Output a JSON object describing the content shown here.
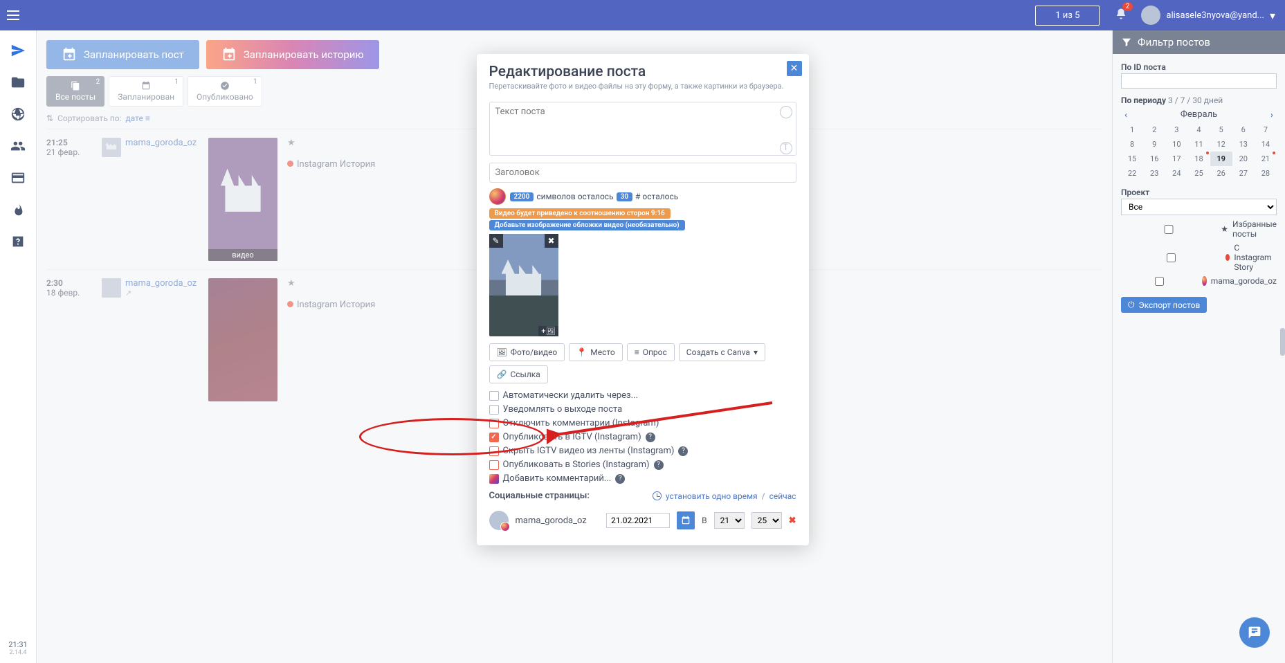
{
  "topbar": {
    "counter": "1 из 5",
    "notif_count": "2",
    "username": "alisasele3nyova@yand..."
  },
  "sidenav": {
    "time": "21:31",
    "version": "2.14.4"
  },
  "actions": {
    "plan_post": "Запланировать пост",
    "plan_story": "Запланировать историю"
  },
  "tabs": {
    "all": "Все посты",
    "all_cnt": "2",
    "planned": "Запланирован",
    "planned_cnt": "1",
    "published": "Опубликовано",
    "published_cnt": "1"
  },
  "sort": {
    "label": "Сортировать по:",
    "value": "дате"
  },
  "posts": [
    {
      "time": "21:25",
      "date": "21 февр.",
      "user": "mama_goroda_oz",
      "kind": "Instagram История",
      "videolabel": "видео"
    },
    {
      "time": "2:30",
      "date": "18 февр.",
      "user": "mama_goroda_oz",
      "kind": "Instagram История"
    }
  ],
  "right": {
    "title": "Фильтр постов",
    "by_id": "По ID поста",
    "by_period": "По периоду",
    "period_links": "3 / 7 / 30 дней",
    "month": "Февраль",
    "project": "Проект",
    "project_all": "Все",
    "fav": "Избранные посты",
    "with_story": "С Instagram Story",
    "acc": "mama_goroda_oz",
    "export": "Экспорт постов"
  },
  "modal": {
    "title": "Редактирование поста",
    "sub": "Перетаскивайте фото и видео файлы на эту форму, а также картинки из браузера.",
    "text_ph": "Текст поста",
    "heading_ph": "Заголовок",
    "chars_left_n": "2200",
    "chars_left_t": "символов осталось",
    "hash_n": "30",
    "hash_t": "# осталось",
    "tag_ratio": "Видео будет приведено к соотношению сторон 9:16",
    "tag_cover": "Добавьте изображение обложки видео (необязательно)",
    "btn_media": "Фото/видео",
    "btn_place": "Место",
    "btn_poll": "Опрос",
    "btn_canva": "Создать с Canva",
    "btn_link": "Ссылка",
    "chk_autodel": "Автоматически удалить через...",
    "chk_notify": "Уведомлять о выходе поста",
    "chk_disablec": "Отключить комментарии (Instagram)",
    "chk_igtv": "Опубликовать в IGTV (Instagram)",
    "chk_hide": "Скрыть IGTV видео из ленты (Instagram)",
    "chk_stories": "Опубликовать в Stories (Instagram)",
    "chk_addcom": "Добавить комментарий...",
    "soc_head": "Социальные страницы:",
    "set_one": "установить одно время",
    "now": "сейчас",
    "acc": "mama_goroda_oz",
    "date": "21.02.2021",
    "v": "В",
    "hour": "21",
    "min": "25"
  }
}
